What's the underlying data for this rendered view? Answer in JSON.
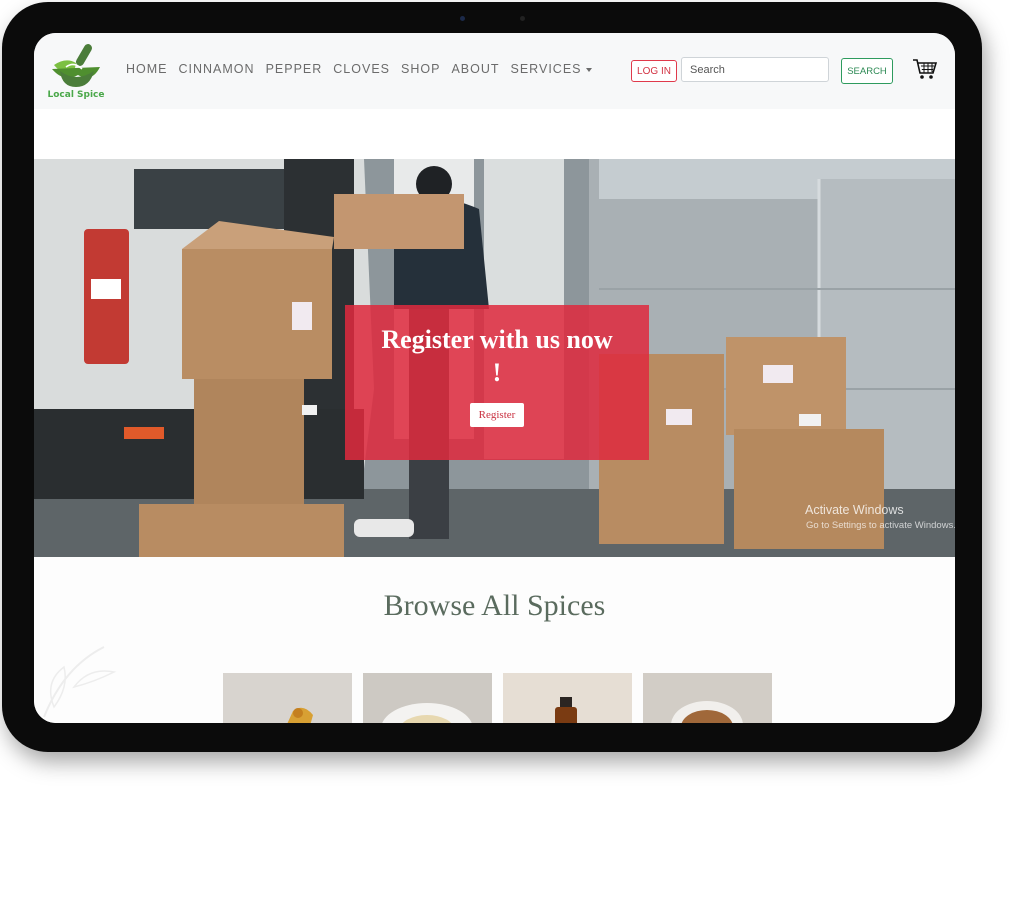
{
  "brand": {
    "name": "Local Spice",
    "color": "#4aa84a"
  },
  "nav": {
    "items": [
      "HOME",
      "CINNAMON",
      "PEPPER",
      "CLOVES",
      "SHOP",
      "ABOUT",
      "SERVICES"
    ],
    "services_has_dropdown": true
  },
  "header": {
    "login_label": "LOG IN",
    "search_placeholder": "Search",
    "search_value": "",
    "search_button": "SEARCH",
    "cart_icon": "shopping-cart-icon"
  },
  "hero": {
    "title": "Register with us now !",
    "button_label": "Register",
    "card_color": "#de2a3e"
  },
  "os_overlay": {
    "watermark_title": "Activate Windows",
    "watermark_subtitle": "Go to Settings to activate Windows."
  },
  "browse": {
    "title": "Browse All Spices",
    "cards": [
      "turmeric-spice-image",
      "bowl-spice-image",
      "bottle-spice-image",
      "ground-spice-image"
    ]
  },
  "colors": {
    "accent_red": "#de2a3e",
    "accent_green": "#2e9b5e",
    "title_green": "#5a6b5e"
  }
}
